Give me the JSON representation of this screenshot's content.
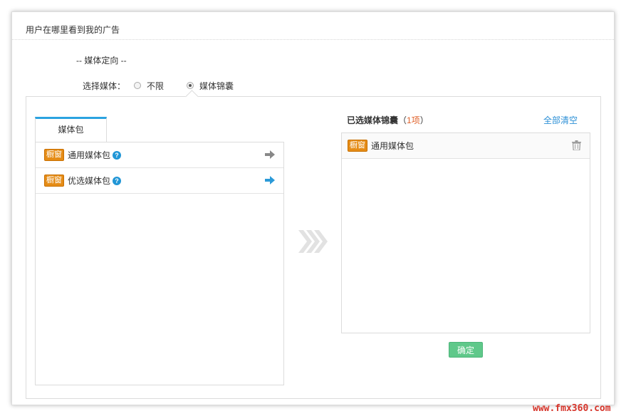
{
  "header": {
    "title": "用户在哪里看到我的广告"
  },
  "section": {
    "label": "-- 媒体定向 --"
  },
  "media_select": {
    "label": "选择媒体：",
    "options": [
      {
        "label": "不限",
        "checked": false
      },
      {
        "label": "媒体锦囊",
        "checked": true
      }
    ]
  },
  "left_panel": {
    "tab_label": "媒体包",
    "items": [
      {
        "badge": "橱窗",
        "label": "通用媒体包",
        "help": "?",
        "arrow_color": "#888888",
        "icon": "arrow-right-icon"
      },
      {
        "badge": "橱窗",
        "label": "优选媒体包",
        "help": "?",
        "arrow_color": "#2b9ad8",
        "icon": "arrow-right-icon"
      }
    ]
  },
  "right_panel": {
    "title": "已选媒体锦囊",
    "count_open": "（",
    "count": "1项",
    "count_close": "）",
    "clear_all": "全部清空",
    "items": [
      {
        "badge": "橱窗",
        "label": "通用媒体包",
        "icon": "trash-icon"
      }
    ]
  },
  "confirm_button": "确定",
  "watermark": "www.fmx360.com",
  "colors": {
    "accent_blue": "#2ba3e0",
    "badge_orange": "#e58c16",
    "confirm_green": "#5fc88a",
    "count_orange": "#e0622b"
  }
}
